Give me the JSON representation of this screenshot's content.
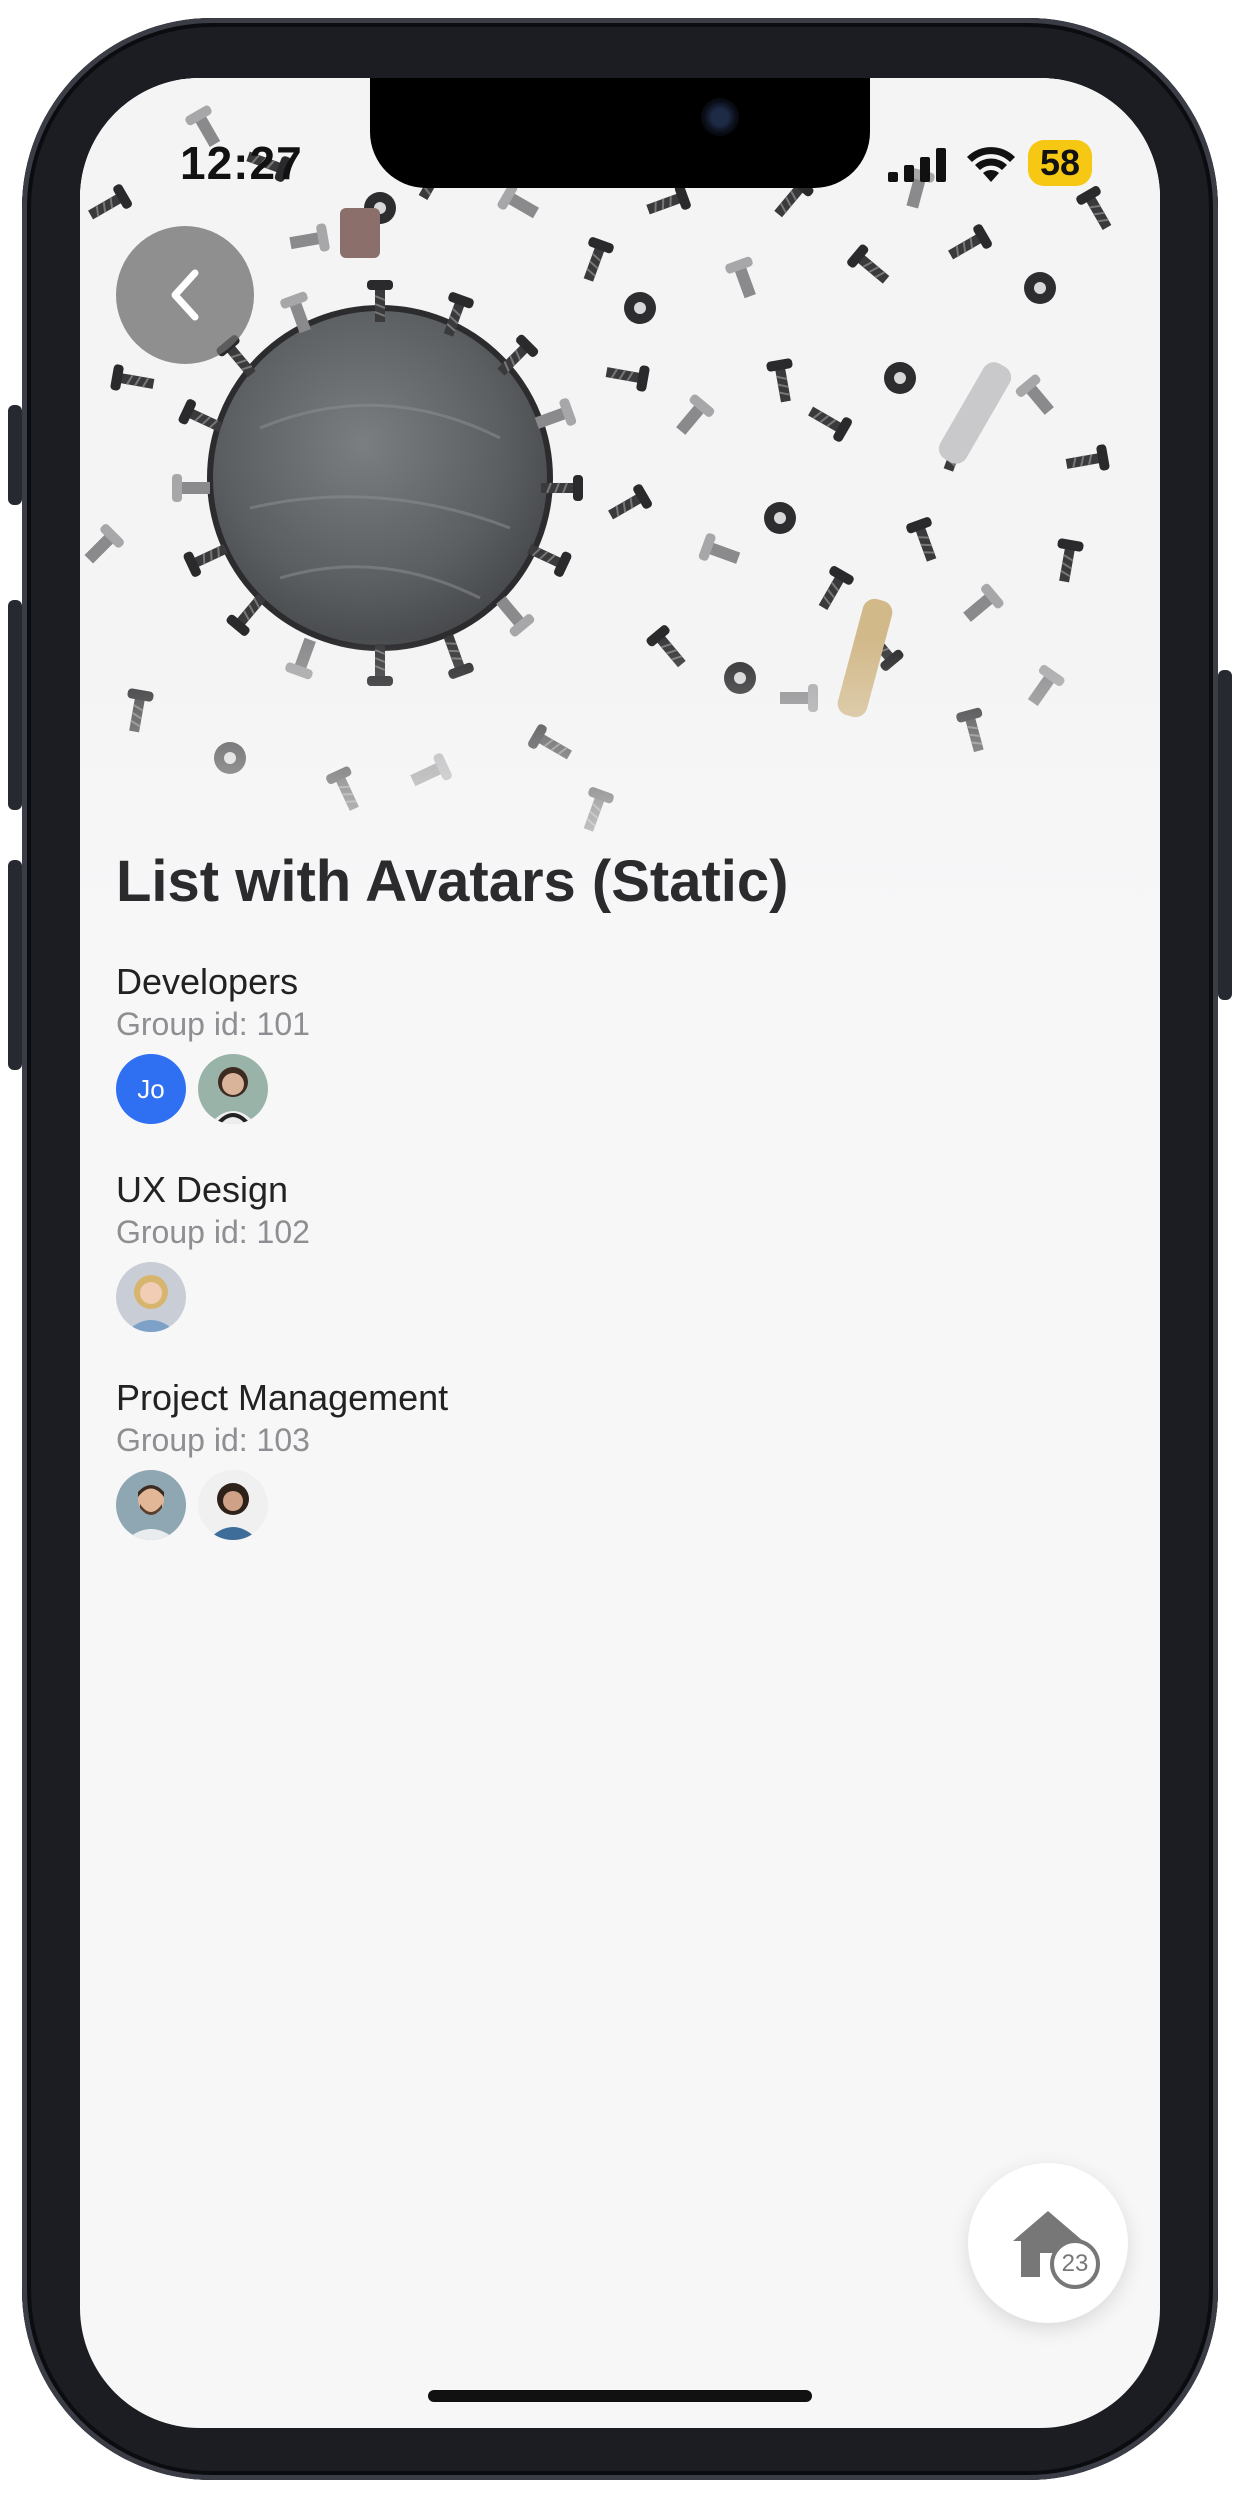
{
  "status_bar": {
    "time": "12:27",
    "battery": "58"
  },
  "page": {
    "title": "List with Avatars (Static)"
  },
  "groups": [
    {
      "name": "Developers",
      "group_id": "Group id: 101",
      "avatars": [
        {
          "type": "initials",
          "text": "Jo"
        },
        {
          "type": "photo",
          "description": "woman-dark-hair"
        }
      ]
    },
    {
      "name": "UX Design",
      "group_id": "Group id: 102",
      "avatars": [
        {
          "type": "photo",
          "description": "woman-blonde"
        }
      ]
    },
    {
      "name": "Project Management",
      "group_id": "Group id: 103",
      "avatars": [
        {
          "type": "photo",
          "description": "man-beard"
        },
        {
          "type": "photo",
          "description": "woman-denim"
        }
      ]
    }
  ],
  "fab": {
    "icon": "home-icon",
    "badge": "23"
  },
  "colors": {
    "accent": "#2f6ff2",
    "battery": "#f6c813",
    "background": "#f7f7f8"
  }
}
